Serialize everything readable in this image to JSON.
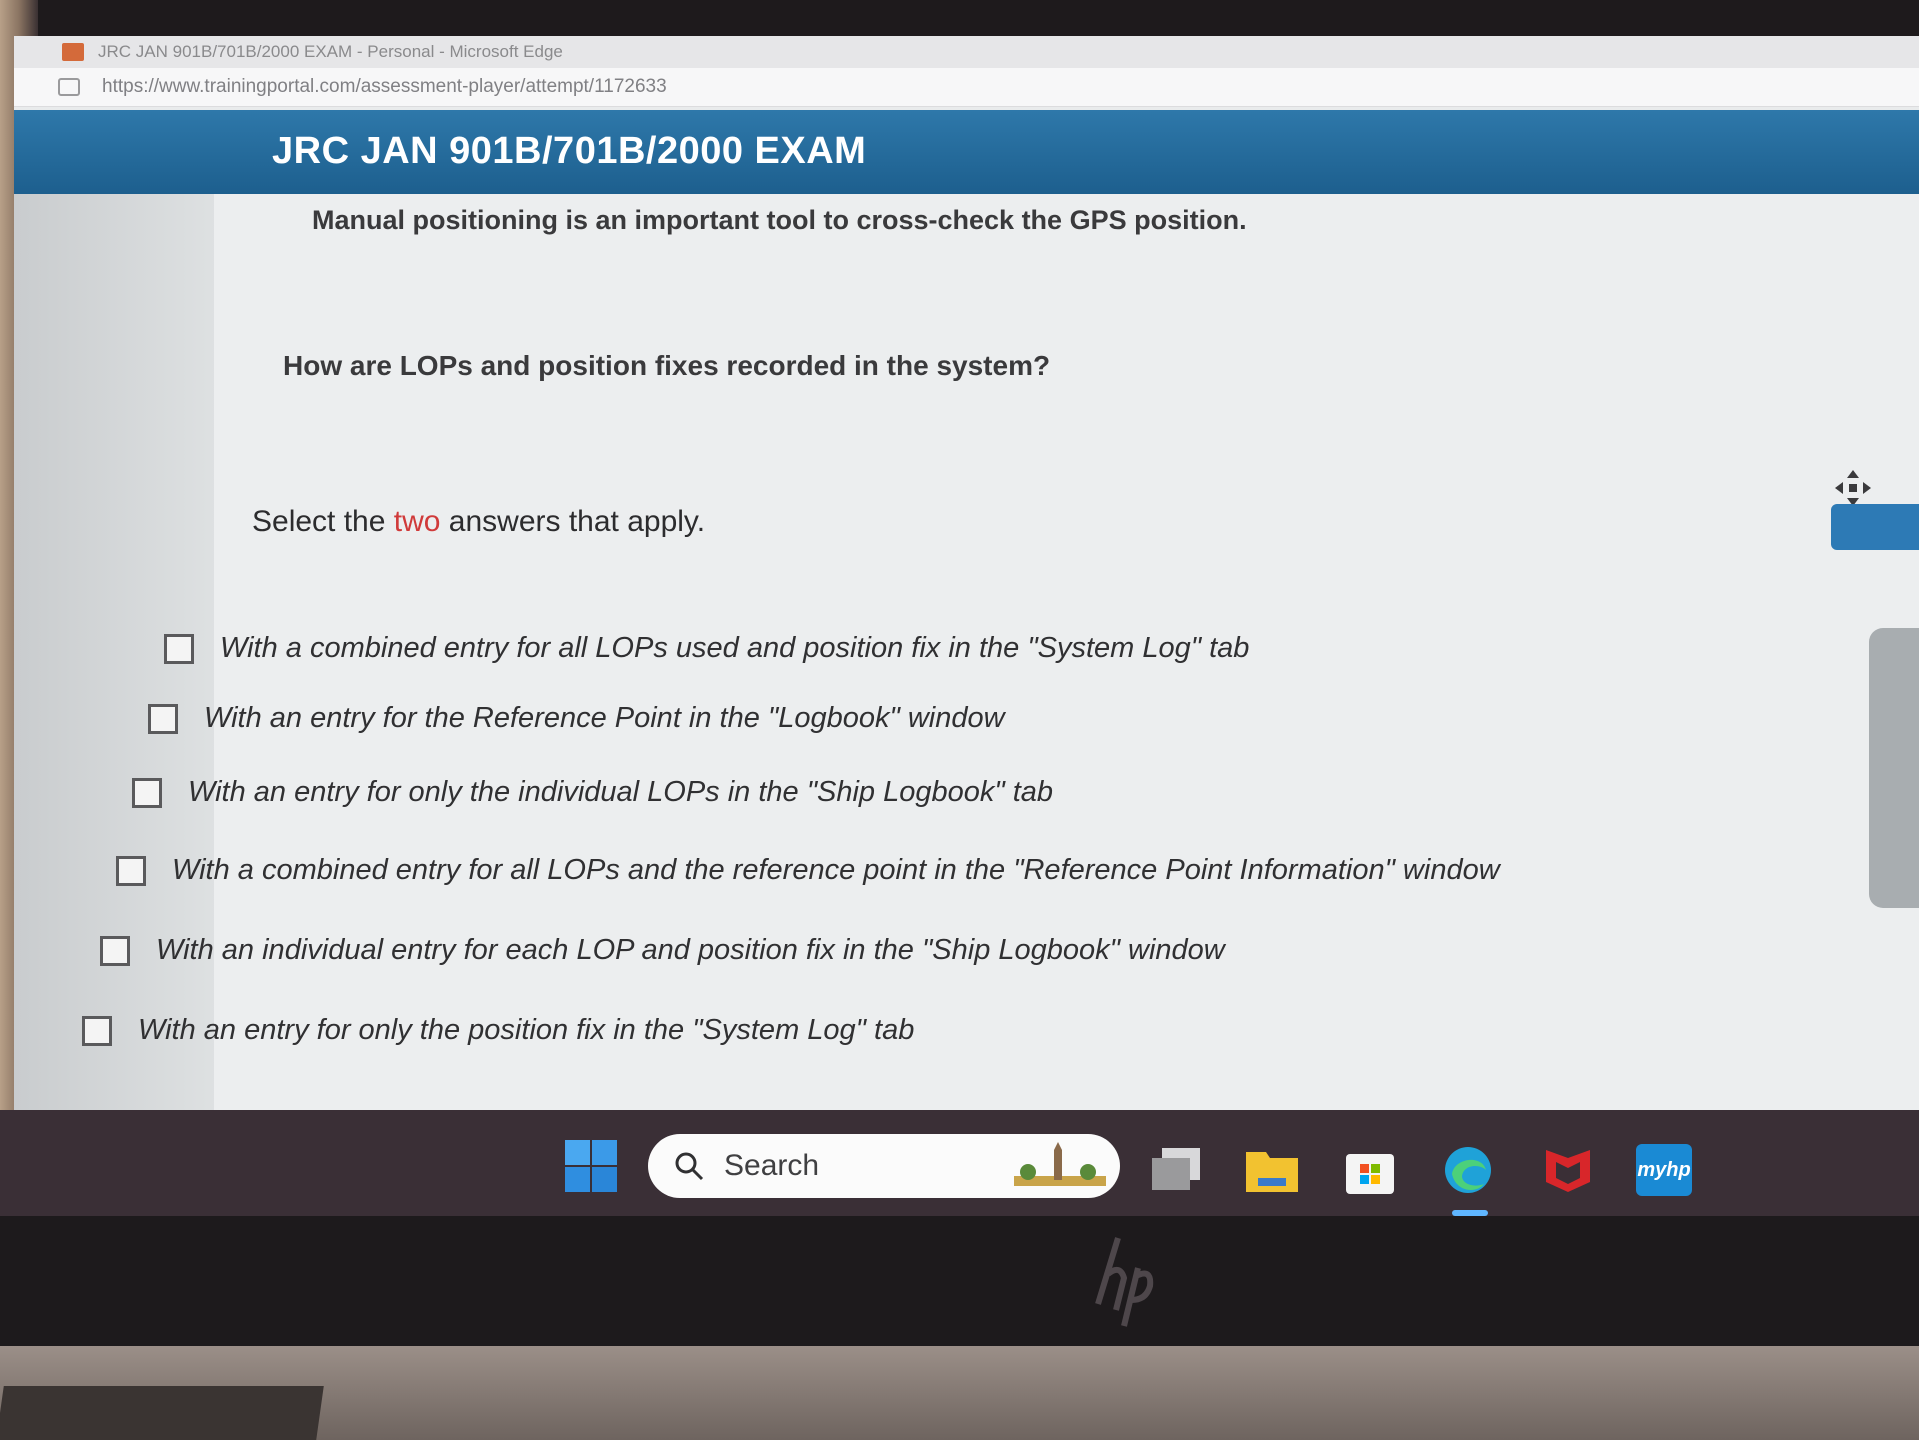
{
  "browser": {
    "title": "JRC JAN 901B/701B/2000 EXAM - Personal - Microsoft Edge",
    "url": "https://www.trainingportal.com/assessment-player/attempt/1172633"
  },
  "exam": {
    "title": "JRC JAN 901B/701B/2000 EXAM"
  },
  "question": {
    "intro": "Manual positioning is an important tool to cross-check the GPS position.",
    "text": "How are LOPs and position fixes recorded in the system?",
    "instruction_prefix": "Select the ",
    "instruction_highlight": "two",
    "instruction_suffix": " answers that apply.",
    "highlight_color": "#d03a3a",
    "options": [
      {
        "label": "With a combined entry for all LOPs used and position fix in the \"System Log\" tab",
        "checked": false
      },
      {
        "label": "With an entry for the Reference Point in the \"Logbook\" window",
        "checked": false
      },
      {
        "label": "With an entry for only the individual LOPs in the \"Ship Logbook\" tab",
        "checked": false
      },
      {
        "label": "With a combined entry for all LOPs and the reference point in the \"Reference Point Information\" window",
        "checked": false
      },
      {
        "label": "With an individual entry for each LOP and position fix in the \"Ship Logbook\" window",
        "checked": false
      },
      {
        "label": "With an entry for only the position fix in the \"System Log\" tab",
        "checked": false
      }
    ]
  },
  "taskbar": {
    "search_label": "Search",
    "icons": [
      "windows-start-icon",
      "task-view-icon",
      "file-explorer-icon",
      "microsoft-store-icon",
      "edge-icon",
      "mcafee-icon",
      "myhp-icon"
    ],
    "myhp_label": "myhp"
  },
  "colors": {
    "header_blue": "#1d5f8e",
    "accent_blue": "#2d7ab5"
  }
}
